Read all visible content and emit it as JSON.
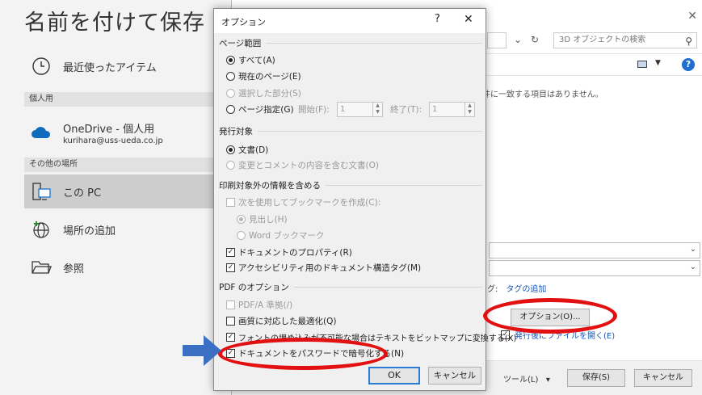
{
  "backstage": {
    "title": "名前を付けて保存",
    "recent_label": "最近使ったアイテム",
    "personal_section": "個人用",
    "onedrive_title": "OneDrive - 個人用",
    "onedrive_email": "kurihara@uss-ueda.co.jp",
    "other_section": "その他の場所",
    "this_pc_label": "この PC",
    "add_place_label": "場所の追加",
    "browse_label": "参照"
  },
  "saveas": {
    "search_placeholder": "3D オブジェクトの検索",
    "empty_message": "件に一致する項目はありません。",
    "tags_label": "グ:",
    "tags_link": "タグの追加",
    "options_button": "オプション(O)...",
    "open_after_label": "発行後にファイルを開く(E)",
    "tools_label": "ツール(L)",
    "save_button": "保存(S)",
    "cancel_button": "キャンセル"
  },
  "options_dialog": {
    "title": "オプション",
    "help": "?",
    "close": "✕",
    "page_range": {
      "heading": "ページ範囲",
      "all": "すべて(A)",
      "current": "現在のページ(E)",
      "selection": "選択した部分(S)",
      "pages": "ページ指定(G)",
      "start_label": "開始(F):",
      "start_value": "1",
      "end_label": "終了(T):",
      "end_value": "1"
    },
    "publish_what": {
      "heading": "発行対象",
      "document": "文書(D)",
      "markup": "変更とコメントの内容を含む文書(O)"
    },
    "non_printing": {
      "heading": "印刷対象外の情報を含める",
      "bookmarks": "次を使用してブックマークを作成(C):",
      "headings": "見出し(H)",
      "word_bookmarks": "Word ブックマーク",
      "properties": "ドキュメントのプロパティ(R)",
      "structure_tags": "アクセシビリティ用のドキュメント構造タグ(M)"
    },
    "pdf_options": {
      "heading": "PDF のオプション",
      "pdfa": "PDF/A 準拠(/)",
      "optimize": "画質に対応した最適化(Q)",
      "bitmap": "フォントの埋め込みが不可能な場合はテキストをビットマップに変換する(X)",
      "encrypt": "ドキュメントをパスワードで暗号化する(N)"
    },
    "ok": "OK",
    "cancel": "キャンセル"
  },
  "colors": {
    "annotation_red": "#e21010",
    "arrow_blue": "#3a6fc4",
    "link_blue": "#1a57b5"
  }
}
